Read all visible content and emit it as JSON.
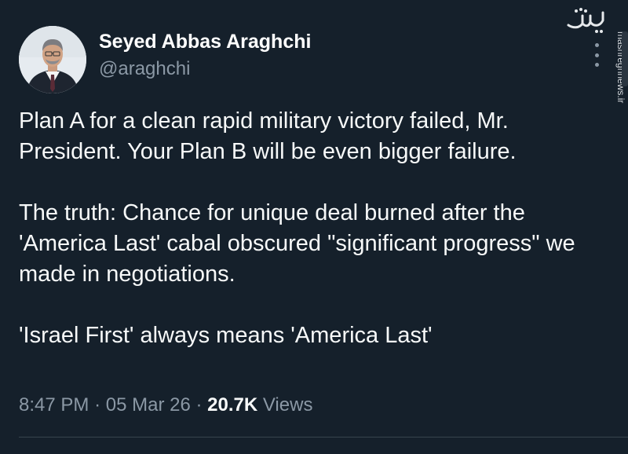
{
  "author": {
    "name": "Seyed Abbas Araghchi",
    "handle": "@araghchi",
    "avatar_icon": "profile-photo"
  },
  "tweet": {
    "paragraphs": [
      "Plan A for a clean rapid military victory failed, Mr. President. Your Plan B will be even bigger failure.",
      "The truth: Chance for unique deal burned after the 'America Last' cabal obscured \"significant progress\" we made in negotiations.",
      "'Israel First' always means 'America Last'"
    ]
  },
  "meta": {
    "time": "8:47 PM",
    "separator": "·",
    "date": "05 Mar 26",
    "views_count": "20.7K",
    "views_label": "Views"
  },
  "watermark": {
    "logo_text": "مشرق",
    "url": "mashreghnews.ir"
  },
  "colors": {
    "background": "#15202b",
    "text": "#f7f9f9",
    "secondary_text": "#8b98a5",
    "divider": "#38444d"
  }
}
